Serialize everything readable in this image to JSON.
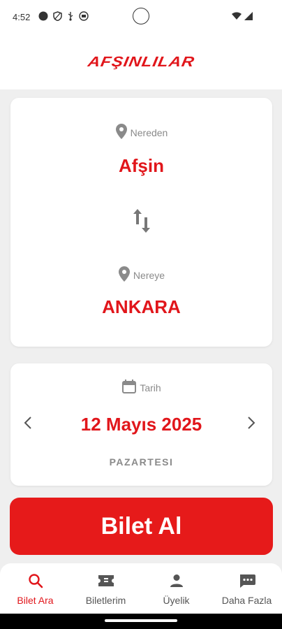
{
  "status": {
    "time": "4:52"
  },
  "brand": {
    "logo_text": "AFŞINLILAR",
    "accent": "#e1161b"
  },
  "route": {
    "from_label": "Nereden",
    "from_value": "Afşin",
    "to_label": "Nereye",
    "to_value": "ANKARA"
  },
  "date": {
    "label": "Tarih",
    "value": "12 Mayıs 2025",
    "weekday": "PAZARTESI"
  },
  "buy_button": {
    "label": "Bilet Al"
  },
  "nav": {
    "items": [
      {
        "label": "Bilet Ara",
        "icon": "search-icon",
        "active": true
      },
      {
        "label": "Biletlerim",
        "icon": "ticket-icon",
        "active": false
      },
      {
        "label": "Üyelik",
        "icon": "person-icon",
        "active": false
      },
      {
        "label": "Daha Fazla",
        "icon": "more-chat-icon",
        "active": false
      }
    ]
  }
}
